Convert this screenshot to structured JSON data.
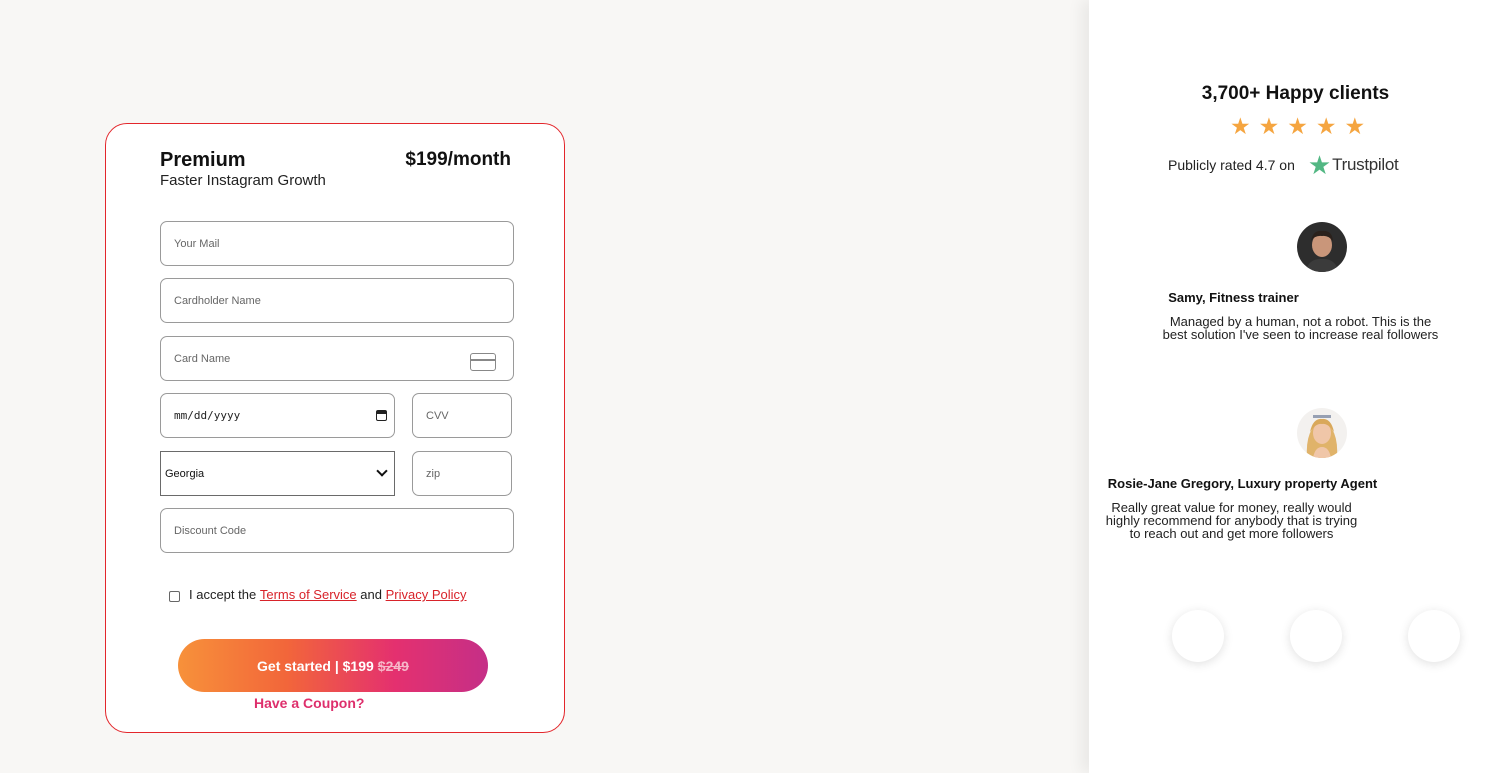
{
  "plan": {
    "name": "Premium",
    "subtitle": "Faster Instagram Growth",
    "price": "$199/month"
  },
  "form": {
    "email_placeholder": "Your Mail",
    "cardholder_placeholder": "Cardholder Name",
    "card_placeholder": "Card Name",
    "date_value": "mm/dd/yyyy",
    "cvv_placeholder": "CVV",
    "state_selected": "Georgia",
    "zip_placeholder": "zip",
    "discount_placeholder": "Discount Code"
  },
  "terms": {
    "prefix": "I accept the",
    "tos": "Terms of Service",
    "and": "and",
    "privacy": "Privacy Policy"
  },
  "cta": {
    "label": "Get started | $199",
    "old_price": "$249"
  },
  "coupon_label": "Have a Coupon?",
  "social": {
    "headline": "3,700+ Happy clients",
    "stars": 5,
    "rated_text": "Publicly rated 4.7 on",
    "trustpilot": "Trustpilot"
  },
  "testimonials": [
    {
      "name": "Samy, Fitness trainer",
      "lines": [
        "Managed by a human, not a robot. This is the",
        "best solution I've seen to increase real followers"
      ]
    },
    {
      "name": "Rosie-Jane Gregory, Luxury property Agent",
      "lines": [
        "Really great value for money, really would",
        "highly recommend for anybody that is trying",
        "to reach out and get more followers"
      ]
    }
  ],
  "colors": {
    "accent": "#d8232a",
    "star": "#f5a540",
    "trustpilot": "#52b783",
    "coupon": "#de2f6c"
  }
}
